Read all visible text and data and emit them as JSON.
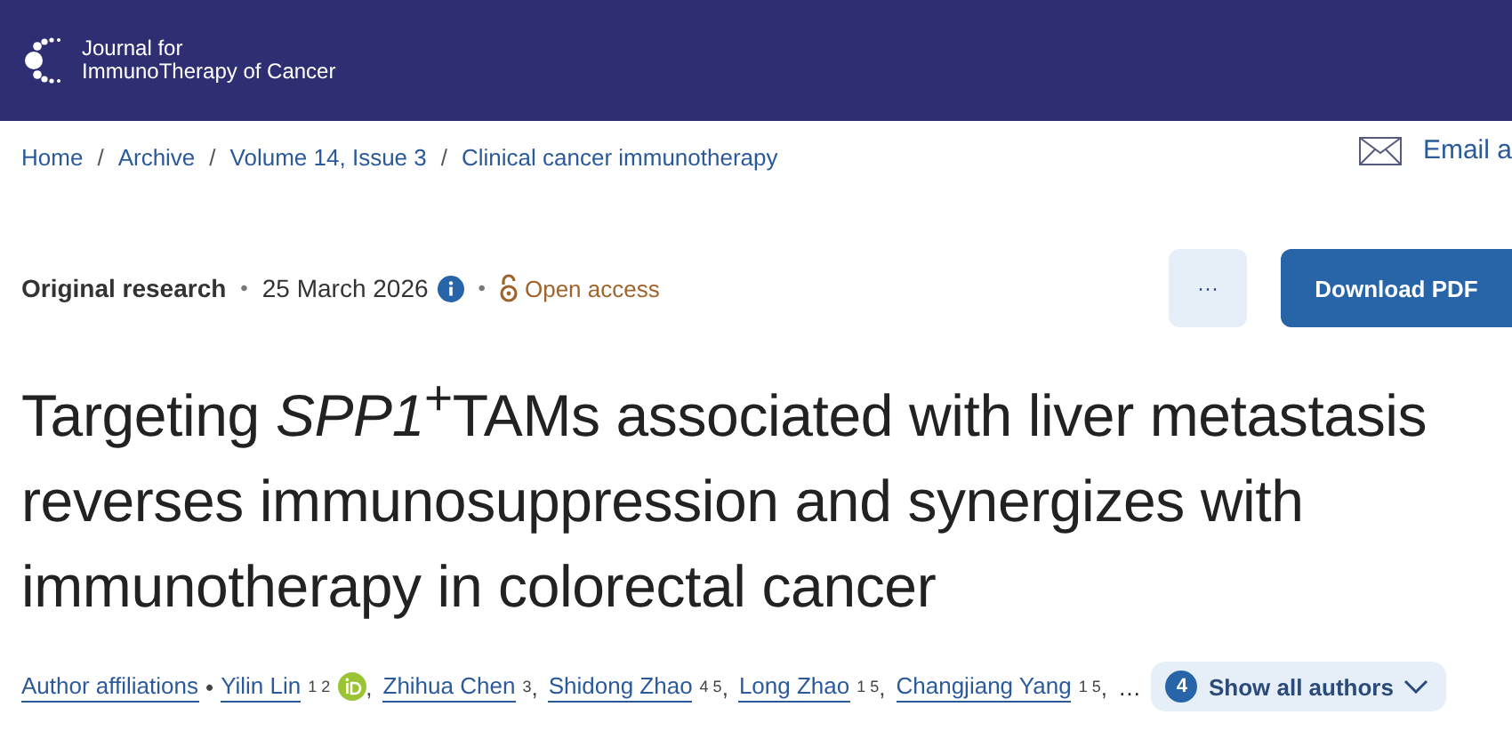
{
  "header": {
    "logo_line1": "Journal for",
    "logo_line2": "ImmunoTherapy of Cancer"
  },
  "breadcrumb": [
    {
      "label": "Home"
    },
    {
      "separator": "/",
      "label": "Archive"
    },
    {
      "separator": "/",
      "label": "Volume 14, Issue 3"
    },
    {
      "separator": "/",
      "label": "Clinical cancer immunotherapy"
    }
  ],
  "email": {
    "label": "Email a"
  },
  "meta": {
    "type": "Original research",
    "separator_1": "•",
    "date": "25 March 2026",
    "separator_2": "•",
    "access": "Open access"
  },
  "actions": {
    "more": "···",
    "download": "Download PDF"
  },
  "title": "Targeting *SPP1*$^{+}$TAMs associated with liver metastasis reverses immunosuppression and synergizes with immunotherapy in colorectal cancer",
  "authors": {
    "affiliations": "Author affiliations",
    "separator": "•",
    "list": [
      {
        "name": "Yilin Lin",
        "sup": "1 2",
        "orcid": true,
        "comma": ","
      },
      {
        "name": "Zhihua Chen",
        "sup": "3",
        "orcid": false,
        "comma": ","
      },
      {
        "name": "Shidong Zhao",
        "sup": "4 5",
        "orcid": false,
        "comma": ","
      },
      {
        "name": "Long Zhao",
        "sup": "1 5",
        "orcid": false,
        "comma": ","
      },
      {
        "name": "Changjiang Yang",
        "sup": "1 5",
        "orcid": false,
        "comma": ","
      }
    ],
    "ellipsis": "…",
    "show_all": {
      "count": "4",
      "label": "Show all authors"
    }
  }
}
